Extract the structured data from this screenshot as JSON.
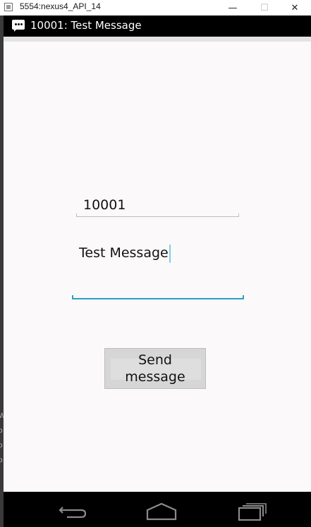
{
  "window": {
    "title": "5554:nexus4_API_14",
    "minimize_glyph": "—",
    "maximize_glyph": "☐",
    "close_glyph": "✕"
  },
  "left_strip_fragments": [
    "W",
    "o",
    "o",
    "o"
  ],
  "action_bar": {
    "icon": "message-icon",
    "title": "10001: Test Message"
  },
  "form": {
    "phone_value": "10001",
    "message_value": "Test Message",
    "send_button_label": "Send\nmessage"
  },
  "nav": {
    "back_icon": "back-icon",
    "home_icon": "home-icon",
    "recent_icon": "recent-apps-icon"
  },
  "colors": {
    "action_bar": "#000000",
    "accent": "#2aa0c4",
    "content_bg": "#fcf9fb",
    "button_bg": "#d6d6d6"
  }
}
